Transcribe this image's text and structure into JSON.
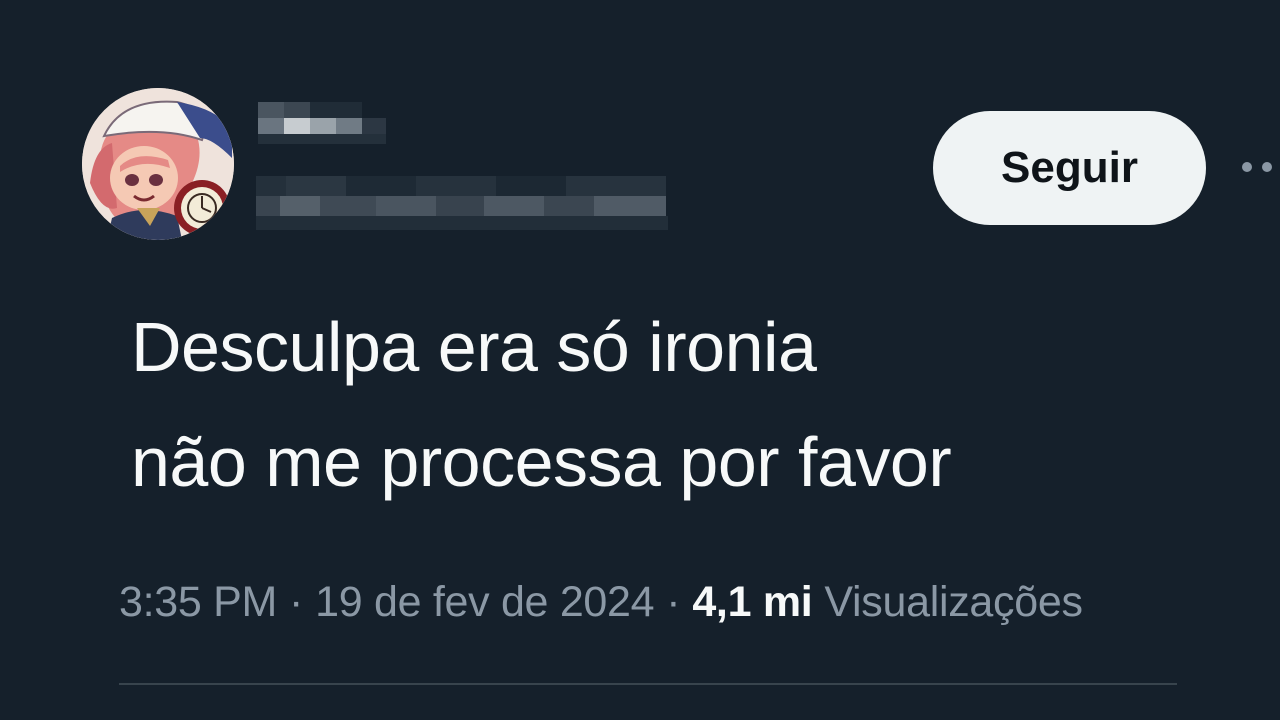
{
  "header": {
    "follow_label": "Seguir",
    "more_icon": "more-horizontal-icon",
    "avatar_icon": "user-avatar"
  },
  "tweet": {
    "text_lines": [
      "Desculpa era só ironia",
      "não me processa por favor"
    ]
  },
  "meta": {
    "time": "3:35 PM",
    "separator": "·",
    "date": "19 de fev de 2024",
    "views_count": "4,1 mi",
    "views_label": "Visualizações"
  },
  "colors": {
    "background": "#15202b",
    "text_primary": "#f7f9f9",
    "text_secondary": "#8b98a5",
    "button_bg": "#eff3f4",
    "divider": "#38444d"
  }
}
